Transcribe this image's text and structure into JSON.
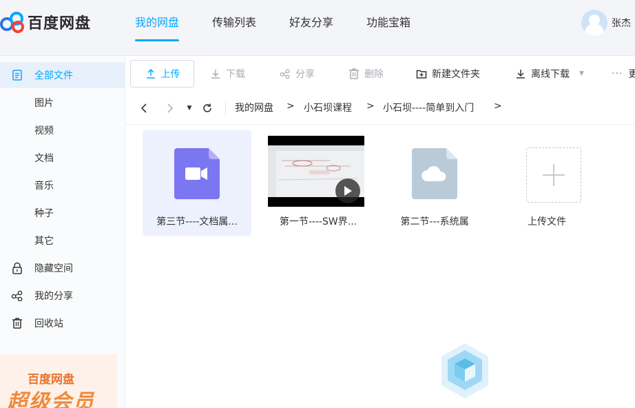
{
  "app": {
    "logo_text": "百度网盘",
    "accent_color": "#06a7ff"
  },
  "nav": {
    "items": [
      {
        "label": "我的网盘",
        "active": true
      },
      {
        "label": "传输列表",
        "active": false
      },
      {
        "label": "好友分享",
        "active": false
      },
      {
        "label": "功能宝箱",
        "active": false
      }
    ]
  },
  "user": {
    "name": "张杰"
  },
  "sidebar": {
    "items": [
      {
        "label": "全部文件",
        "icon": "file-list-icon",
        "active": true
      },
      {
        "label": "图片",
        "icon": "",
        "active": false
      },
      {
        "label": "视频",
        "icon": "",
        "active": false
      },
      {
        "label": "文档",
        "icon": "",
        "active": false
      },
      {
        "label": "音乐",
        "icon": "",
        "active": false
      },
      {
        "label": "种子",
        "icon": "",
        "active": false
      },
      {
        "label": "其它",
        "icon": "",
        "active": false
      },
      {
        "label": "隐藏空间",
        "icon": "lock-icon",
        "active": false
      },
      {
        "label": "我的分享",
        "icon": "share-icon",
        "active": false
      },
      {
        "label": "回收站",
        "icon": "trash-icon",
        "active": false
      }
    ],
    "promo": {
      "title": "百度网盘",
      "big": "超级会员"
    }
  },
  "toolbar": {
    "upload": "上传",
    "download": "下载",
    "share": "分享",
    "delete": "删除",
    "new_folder": "新建文件夹",
    "offline_download": "离线下载",
    "more": "更"
  },
  "breadcrumb": {
    "items": [
      "我的网盘",
      "小石坝课程",
      "小石坝----简单到入门"
    ],
    "separator": ">"
  },
  "files": [
    {
      "name": "第三节----文档属...",
      "type": "video-file",
      "color": "#7b76f2",
      "selected": true
    },
    {
      "name": "第一节----SW界...",
      "type": "video-thumbnail",
      "selected": false
    },
    {
      "name": "第二节---系统属",
      "type": "cloud-file",
      "color": "#b9cad8",
      "selected": false
    },
    {
      "name": "上传文件",
      "type": "upload-placeholder",
      "selected": false
    }
  ]
}
